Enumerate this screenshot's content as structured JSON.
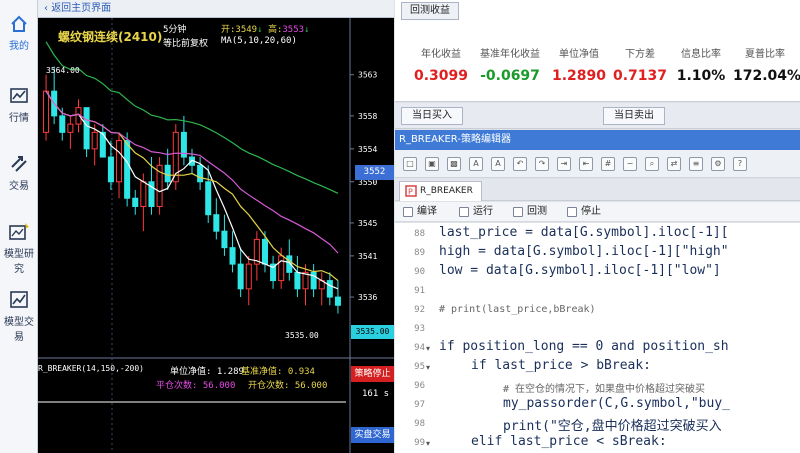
{
  "sidebar": {
    "items": [
      {
        "label": "我的",
        "icon": "home-icon",
        "active": true
      },
      {
        "label": "行情",
        "icon": "market-chart-icon"
      },
      {
        "label": "交易",
        "icon": "trade-arrows-icon"
      },
      {
        "label": "模型研究",
        "icon": "model-research-icon"
      },
      {
        "label": "模型交易",
        "icon": "model-trade-icon"
      }
    ]
  },
  "chart_panel": {
    "back_link": "返回主页界面",
    "symbol": "螺纹钢连续(2410)",
    "period": "5分钟",
    "adjust": "等比前复权",
    "open_label": "开:",
    "open_value": "3549",
    "high_label": "高:",
    "high_value": "3553",
    "ma_label": "MA(5,10,20,60)",
    "peak_label": "3564.00",
    "low_label": "3535.00",
    "current_price": "3552",
    "last_price_tag": "3535.00",
    "indicator_label": "R_BREAKER(14,150,-200)",
    "unit_nav_label": "单位净值",
    "unit_nav_value": "1.289",
    "bench_nav_label": "基准净值",
    "bench_nav_value": "0.934",
    "close_count_label": "平仓次数",
    "close_count_value": "56.000",
    "open_count_label": "开仓次数",
    "open_count_value": "56.000",
    "stop_button": "策略停止",
    "timer": "161 s",
    "live_button": "实盘交易"
  },
  "chart_data": {
    "type": "candlestick",
    "y_ticks": [
      3563,
      3558,
      3554,
      3550,
      3545,
      3541,
      3536
    ],
    "ylim": [
      3532,
      3566
    ],
    "candles": [
      [
        3556,
        3563,
        3555,
        3561
      ],
      [
        3561,
        3564,
        3557,
        3558
      ],
      [
        3558,
        3559,
        3555,
        3556
      ],
      [
        3556,
        3558,
        3554,
        3557
      ],
      [
        3557,
        3560,
        3556,
        3559
      ],
      [
        3559,
        3559,
        3553,
        3554
      ],
      [
        3554,
        3557,
        3552,
        3556
      ],
      [
        3556,
        3557,
        3553,
        3553
      ],
      [
        3553,
        3555,
        3549,
        3550
      ],
      [
        3550,
        3556,
        3548,
        3555
      ],
      [
        3555,
        3556,
        3547,
        3548
      ],
      [
        3548,
        3549,
        3546,
        3547
      ],
      [
        3547,
        3551,
        3544,
        3550
      ],
      [
        3550,
        3553,
        3546,
        3547
      ],
      [
        3547,
        3553,
        3546,
        3552
      ],
      [
        3552,
        3554,
        3549,
        3550
      ],
      [
        3550,
        3557,
        3549,
        3556
      ],
      [
        3556,
        3558,
        3552,
        3553
      ],
      [
        3553,
        3554,
        3551,
        3552
      ],
      [
        3552,
        3553,
        3549,
        3550
      ],
      [
        3550,
        3552,
        3545,
        3546
      ],
      [
        3546,
        3548,
        3543,
        3544
      ],
      [
        3544,
        3546,
        3541,
        3542
      ],
      [
        3542,
        3544,
        3539,
        3540
      ],
      [
        3540,
        3542,
        3536,
        3537
      ],
      [
        3537,
        3541,
        3535,
        3540
      ],
      [
        3540,
        3544,
        3538,
        3543
      ],
      [
        3543,
        3544,
        3539,
        3540
      ],
      [
        3540,
        3541,
        3537,
        3538
      ],
      [
        3538,
        3542,
        3537,
        3541
      ],
      [
        3541,
        3543,
        3538,
        3539
      ],
      [
        3539,
        3541,
        3536,
        3537
      ],
      [
        3537,
        3540,
        3535,
        3539
      ],
      [
        3539,
        3540,
        3536,
        3537
      ],
      [
        3537,
        3539,
        3535,
        3538
      ],
      [
        3538,
        3539,
        3535,
        3536
      ],
      [
        3536,
        3538,
        3534,
        3535
      ]
    ],
    "ma_colors": [
      "#ffffff",
      "#e8d54a",
      "#d65ad6",
      "#2db84e"
    ]
  },
  "stats_panel": {
    "tab": "回测收益",
    "headers": [
      "年化收益",
      "基准年化收益",
      "单位净值",
      "下方差",
      "信息比率",
      "夏普比率"
    ],
    "values": [
      {
        "text": "0.3099",
        "color": "#e02020"
      },
      {
        "text": "-0.0697",
        "color": "#1a9a2a"
      },
      {
        "text": "1.2890",
        "color": "#e02020"
      },
      {
        "text": "0.7137",
        "color": "#e02020"
      },
      {
        "text": "1.10%",
        "color": "#111111"
      },
      {
        "text": "172.04%",
        "color": "#111111"
      }
    ]
  },
  "trade_bar": {
    "buy_label": "当日买入",
    "sell_label": "当日卖出"
  },
  "editor": {
    "title": "R_BREAKER-策略编辑器",
    "file_tab": "R_BREAKER",
    "compile": "编译",
    "run": "运行",
    "backtest": "回测",
    "stop": "停止",
    "lines": [
      {
        "n": "88",
        "text": "last_price = data[G.symbol].iloc[-1][",
        "size": 13,
        "color": "#1a2f5a",
        "indent": 0
      },
      {
        "n": "89",
        "text": "high = data[G.symbol].iloc[-1][\"high\"",
        "size": 13,
        "color": "#1a2f5a",
        "indent": 0
      },
      {
        "n": "90",
        "text": "low = data[G.symbol].iloc[-1][\"low\"]",
        "size": 13,
        "color": "#1a2f5a",
        "indent": 0
      },
      {
        "n": "91",
        "text": "",
        "size": 13,
        "color": "#1a2f5a",
        "indent": 0
      },
      {
        "n": "92",
        "text": "# print(last_price,bBreak)",
        "size": 10,
        "color": "#666666",
        "indent": 0
      },
      {
        "n": "93",
        "text": "",
        "size": 13,
        "color": "#1a2f5a",
        "indent": 0
      },
      {
        "n": "94",
        "text": "if position_long == 0 and position_sh",
        "size": 13,
        "color": "#1a2f5a",
        "indent": 0,
        "fold": true
      },
      {
        "n": "95",
        "text": "if last_price > bBreak:",
        "size": 13,
        "color": "#1a2f5a",
        "indent": 4,
        "fold": true
      },
      {
        "n": "96",
        "text": "# 在空仓的情况下，如果盘中价格超过突破买",
        "size": 10,
        "color": "#666666",
        "indent": 8
      },
      {
        "n": "97",
        "text": "my_passorder(C,G.symbol,\"buy_",
        "size": 13,
        "color": "#1a2f5a",
        "indent": 8
      },
      {
        "n": "98",
        "text": "print(\"空仓,盘中价格超过突破买入",
        "size": 13,
        "color": "#1a2f5a",
        "indent": 8
      },
      {
        "n": "99",
        "text": "elif last_price < sBreak:",
        "size": 13,
        "color": "#1a2f5a",
        "indent": 4,
        "fold": true
      }
    ]
  }
}
